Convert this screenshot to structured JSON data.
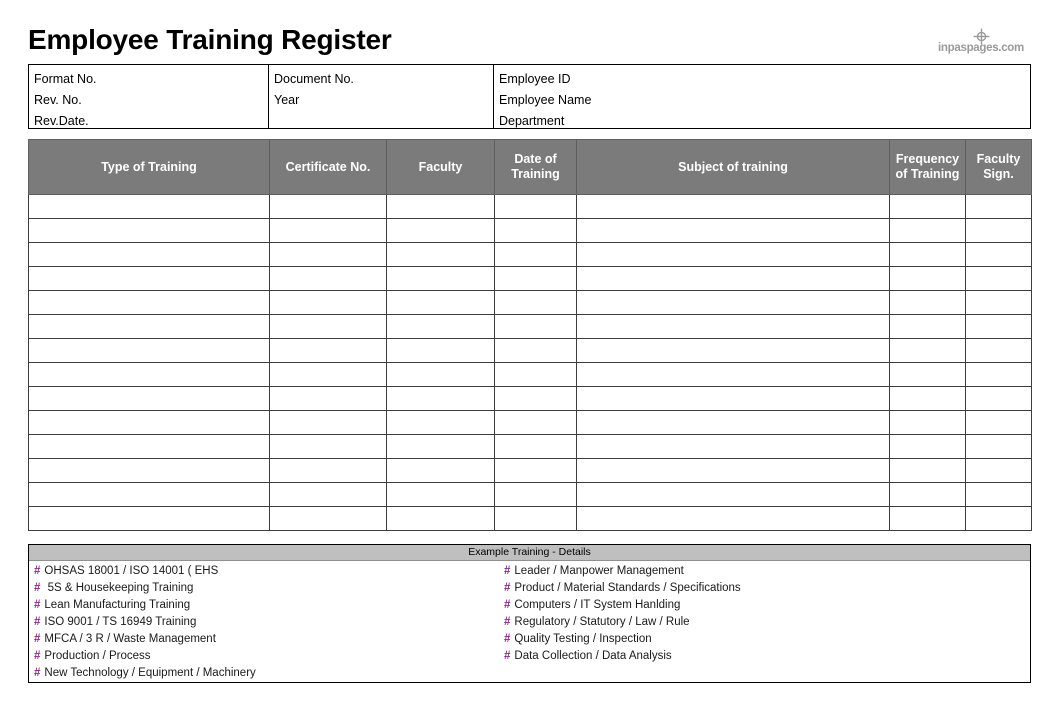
{
  "document": {
    "title": "Employee Training Register"
  },
  "watermark": {
    "icon": "crosshair-target-icon",
    "text": "inpaspages.com"
  },
  "info_block": {
    "columns": [
      {
        "lines": [
          "Format No.",
          "Rev. No.",
          "Rev.Date."
        ]
      },
      {
        "lines": [
          "Document No.",
          "Year",
          ""
        ]
      },
      {
        "lines": [
          "Employee ID",
          "Employee Name",
          "Department"
        ]
      }
    ]
  },
  "register": {
    "headers": [
      "Type of Training",
      "Certificate No.",
      "Faculty",
      "Date of Training",
      "Subject of training",
      "Frequency of Training",
      "Faculty Sign."
    ],
    "header_lines": [
      [
        "Type of Training"
      ],
      [
        "Certificate No."
      ],
      [
        "Faculty"
      ],
      [
        "Date of",
        "Training"
      ],
      [
        "Subject of training"
      ],
      [
        "Frequency",
        "of Training"
      ],
      [
        "Faculty",
        "Sign."
      ]
    ],
    "row_count": 14,
    "rows": [
      [
        "",
        "",
        "",
        "",
        "",
        "",
        ""
      ],
      [
        "",
        "",
        "",
        "",
        "",
        "",
        ""
      ],
      [
        "",
        "",
        "",
        "",
        "",
        "",
        ""
      ],
      [
        "",
        "",
        "",
        "",
        "",
        "",
        ""
      ],
      [
        "",
        "",
        "",
        "",
        "",
        "",
        ""
      ],
      [
        "",
        "",
        "",
        "",
        "",
        "",
        ""
      ],
      [
        "",
        "",
        "",
        "",
        "",
        "",
        ""
      ],
      [
        "",
        "",
        "",
        "",
        "",
        "",
        ""
      ],
      [
        "",
        "",
        "",
        "",
        "",
        "",
        ""
      ],
      [
        "",
        "",
        "",
        "",
        "",
        "",
        ""
      ],
      [
        "",
        "",
        "",
        "",
        "",
        "",
        ""
      ],
      [
        "",
        "",
        "",
        "",
        "",
        "",
        ""
      ],
      [
        "",
        "",
        "",
        "",
        "",
        "",
        ""
      ],
      [
        "",
        "",
        "",
        "",
        "",
        "",
        ""
      ]
    ]
  },
  "details": {
    "heading": "Example Training - Details",
    "bullet": "#",
    "left_items": [
      "OHSAS 18001 / ISO 14001 ( EHS",
      " 5S & Housekeeping Training",
      "Lean Manufacturing Training",
      "ISO 9001 / TS 16949 Training",
      "MFCA / 3 R / Waste Management",
      "Production / Process",
      "New Technology / Equipment / Machinery"
    ],
    "right_items": [
      "Leader / Manpower Management",
      "Product / Material Standards / Specifications",
      "Computers / IT System Hanlding",
      "Regulatory / Statutory / Law / Rule",
      "Quality Testing / Inspection",
      "Data Collection / Data Analysis"
    ]
  },
  "colors": {
    "header_gray": "#7b7b7b",
    "banner_gray": "#bfbfbf",
    "bullet_purple": "#8b2a8b",
    "watermark_gray": "#9a9a9a"
  }
}
